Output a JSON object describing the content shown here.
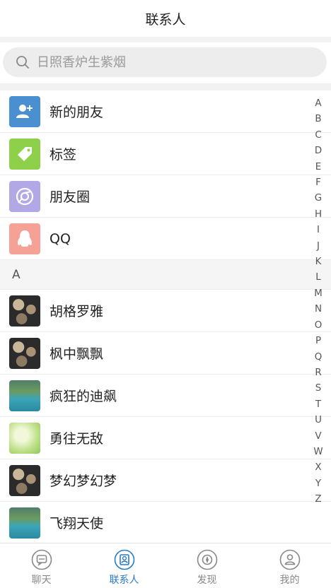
{
  "header": {
    "title": "联系人"
  },
  "search": {
    "placeholder": "日照香炉生紫烟"
  },
  "func_items": [
    {
      "label": "新的朋友",
      "icon": "add-friend-icon",
      "color": "#4a8fd0"
    },
    {
      "label": "标签",
      "icon": "tag-icon",
      "color": "#8fd04a"
    },
    {
      "label": "朋友圈",
      "icon": "moments-icon",
      "color": "#b3a8e6"
    },
    {
      "label": "QQ",
      "icon": "qq-penguin-icon",
      "color": "#f5a196"
    }
  ],
  "section": {
    "letter": "A"
  },
  "contacts": [
    {
      "name": "胡格罗雅",
      "avatar": "stones-photo"
    },
    {
      "name": "枫中飘飘",
      "avatar": "stones-photo"
    },
    {
      "name": "疯狂的迪飙",
      "avatar": "lake-photo"
    },
    {
      "name": "勇往无敌",
      "avatar": "green-photo"
    },
    {
      "name": "梦幻梦幻梦",
      "avatar": "stones-photo"
    },
    {
      "name": "飞翔天使",
      "avatar": "lake-photo"
    }
  ],
  "index_letters": [
    "A",
    "B",
    "C",
    "D",
    "E",
    "F",
    "G",
    "H",
    "I",
    "J",
    "K",
    "L",
    "M",
    "N",
    "O",
    "P",
    "Q",
    "R",
    "S",
    "T",
    "U",
    "V",
    "W",
    "X",
    "Y",
    "Z"
  ],
  "tabs": [
    {
      "label": "聊天",
      "icon": "chat-icon",
      "active": false
    },
    {
      "label": "联系人",
      "icon": "contacts-icon",
      "active": true
    },
    {
      "label": "发现",
      "icon": "discover-icon",
      "active": false
    },
    {
      "label": "我的",
      "icon": "profile-icon",
      "active": false
    }
  ],
  "colors": {
    "accent": "#2b79c6",
    "inactive": "#888888"
  }
}
